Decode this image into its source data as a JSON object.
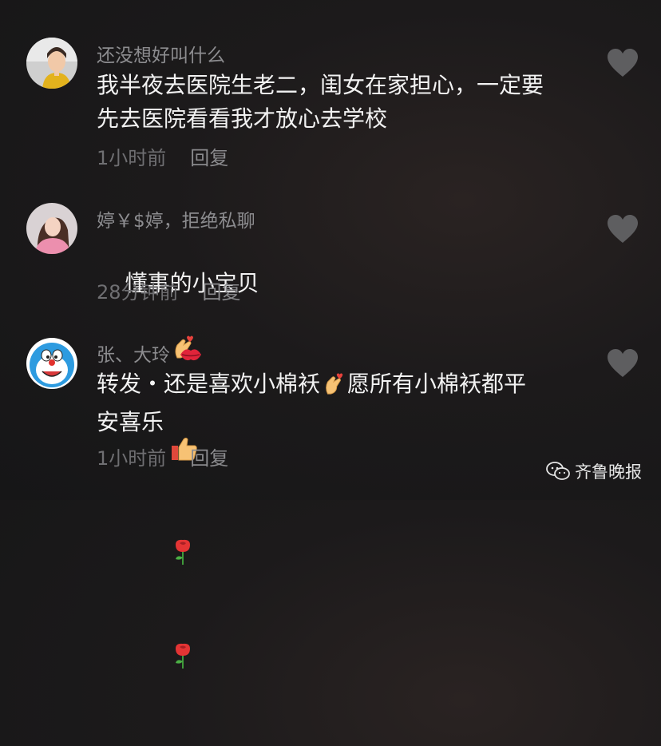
{
  "comments": [
    {
      "username": "还没想好叫什么",
      "text": "我半夜去医院生老二，闺女在家担心，一定要\n先去医院看看我才放心去学校",
      "time": "1小时前",
      "reply": "回复"
    },
    {
      "username": "婷￥$婷，拒绝私聊",
      "text": "懂事的小宝贝",
      "emojis": [
        "finger-heart-emoji",
        "thumbs-up-emoji",
        "rose-emoji",
        "rose-emoji"
      ],
      "time": "28分钟前",
      "reply": "回复"
    },
    {
      "username": "张、大玲",
      "username_emoji": "kiss-lips-emoji",
      "text_part1": "转发・还是喜欢小棉袄",
      "text_emoji": "finger-heart-emoji",
      "text_part2": "愿所有小棉袄都平\n安喜乐",
      "time": "1小时前",
      "reply": "回复"
    }
  ],
  "watermark": {
    "label": "齐鲁晚报",
    "icon": "wechat-icon"
  },
  "colors": {
    "text": "#f2f2f2",
    "username": "#8c8c8f",
    "meta": "#6f6f72",
    "heart": "#5e5e60"
  }
}
